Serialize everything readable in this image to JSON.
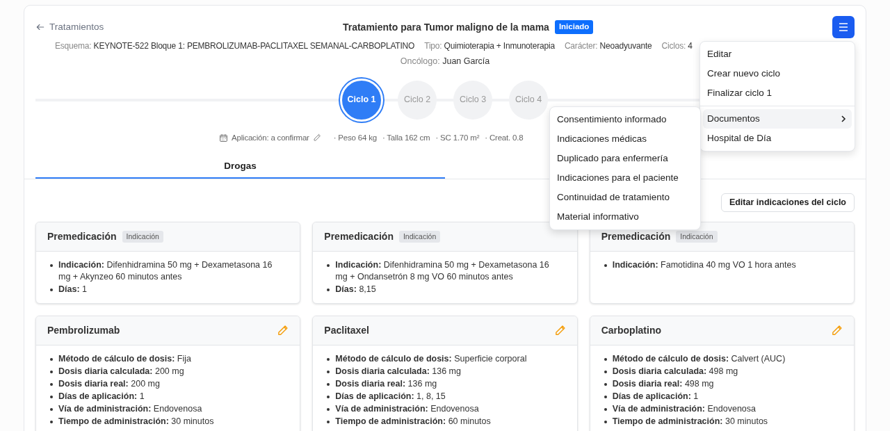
{
  "header": {
    "back_link": "Tratamientos",
    "title": "Tratamiento para Tumor maligno de la mama",
    "status_badge": "Iniciado"
  },
  "meta": [
    {
      "label": "Esquema:",
      "value": "KEYNOTE-522 Bloque 1: PEMBROLIZUMAB-PACLITAXEL SEMANAL-CARBOPLATINO"
    },
    {
      "label": "Tipo:",
      "value": "Quimioterapia + Inmunoterapia"
    },
    {
      "label": "Carácter:",
      "value": "Neoadyuvante"
    },
    {
      "label": "Ciclos:",
      "value": "4"
    }
  ],
  "oncologist": {
    "label": "Oncólogo:",
    "value": "Juan García"
  },
  "cycles": [
    {
      "label": "Ciclo 1",
      "selected": true
    },
    {
      "label": "Ciclo 2",
      "selected": false
    },
    {
      "label": "Ciclo 3",
      "selected": false
    },
    {
      "label": "Ciclo 4",
      "selected": false
    }
  ],
  "cycle_info": {
    "application": "Aplicación: a confirmar",
    "stats": [
      "· Peso 64 kg",
      "· Talla 162 cm",
      "· SC 1.70 m²",
      "· Creat. 0.8"
    ]
  },
  "tabs": [
    {
      "label": "Drogas",
      "selected": true
    }
  ],
  "edit_button": "Editar indicaciones del ciclo",
  "premedication_cards": [
    {
      "title": "Premedicación",
      "badge": "Indicación",
      "items": [
        "**Indicación:** Difenhidramina 50 mg + Dexametasona 16 mg + Akynzeo 60 minutos antes",
        "**Días:** 1"
      ]
    },
    {
      "title": "Premedicación",
      "badge": "Indicación",
      "items": [
        "**Indicación:** Difenhidramina 50 mg + Dexametasona 16 mg + Ondansetrón 8 mg VO 60 minutos antes",
        "**Días:** 8,15"
      ]
    },
    {
      "title": "Premedicación",
      "badge": "Indicación",
      "items": [
        "**Indicación:** Famotidina 40 mg VO 1 hora antes"
      ]
    }
  ],
  "drug_cards": [
    {
      "title": "Pembrolizumab",
      "items": [
        "**Método de cálculo de dosis:** Fija",
        "**Dosis diaria calculada:** 200 mg",
        "**Dosis diaria real:** 200 mg",
        "**Días de aplicación:** 1",
        "**Vía de administración:** Endovenosa",
        "**Tiempo de administración:** 30 minutos"
      ]
    },
    {
      "title": "Paclitaxel",
      "items": [
        "**Método de cálculo de dosis:** Superficie corporal",
        "**Dosis diaria calculada:** 136 mg",
        "**Dosis diaria real:** 136 mg",
        "**Días de aplicación:** 1, 8, 15",
        "**Vía de administración:** Endovenosa",
        "**Tiempo de administración:** 60 minutos"
      ]
    },
    {
      "title": "Carboplatino",
      "items": [
        "**Método de cálculo de dosis:** Calvert (AUC)",
        "**Dosis diaria calculada:** 498 mg",
        "**Dosis diaria real:** 498 mg",
        "**Días de aplicación:** 1",
        "**Vía de administración:** Endovenosa",
        "**Tiempo de administración:** 30 minutos"
      ]
    }
  ],
  "menu": {
    "groups": [
      [
        {
          "label": "Editar",
          "kind": "item",
          "selected": false
        },
        {
          "label": "Crear nuevo ciclo",
          "kind": "item",
          "selected": false
        },
        {
          "label": "Finalizar ciclo 1",
          "kind": "item",
          "selected": false
        }
      ],
      [
        {
          "label": "Documentos",
          "kind": "submenu",
          "selected": true
        },
        {
          "label": "Hospital de Día",
          "kind": "item",
          "selected": false
        }
      ]
    ],
    "submenu": [
      "Consentimiento informado",
      "Indicaciones médicas",
      "Duplicado para enfermería",
      "Indicaciones para el paciente",
      "Continuidad de tratamiento",
      "Material informativo"
    ]
  }
}
